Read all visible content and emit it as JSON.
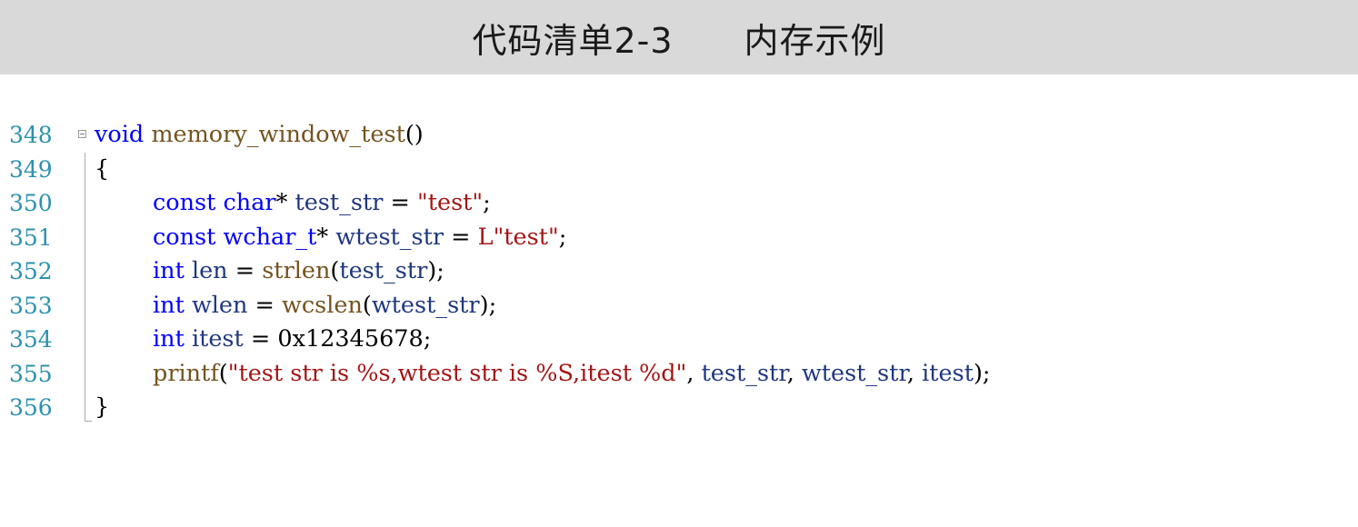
{
  "title": "代码清单2-3　　内存示例",
  "code_lines": [
    {
      "number": "348",
      "tokens": [
        "void",
        " ",
        "memory_window_test",
        "()"
      ]
    },
    {
      "number": "349",
      "tokens": [
        "{"
      ]
    },
    {
      "number": "350",
      "tokens": [
        "const",
        " ",
        "char",
        "*",
        " ",
        "test_str",
        " = ",
        "\"test\"",
        ";"
      ]
    },
    {
      "number": "351",
      "tokens": [
        "const",
        " ",
        "wchar_t",
        "*",
        " ",
        "wtest_str",
        " = ",
        "L\"test\"",
        ";"
      ]
    },
    {
      "number": "352",
      "tokens": [
        "int",
        " ",
        "len",
        " = ",
        "strlen",
        "(",
        "test_str",
        ");"
      ]
    },
    {
      "number": "353",
      "tokens": [
        "int",
        " ",
        "wlen",
        " = ",
        "wcslen",
        "(",
        "wtest_str",
        ");"
      ]
    },
    {
      "number": "354",
      "tokens": [
        "int",
        " ",
        "itest",
        " = ",
        "0x12345678",
        ";"
      ]
    },
    {
      "number": "355",
      "tokens": [
        "printf",
        "(",
        "\"test str is %s,wtest str is %S,itest %d\"",
        ", ",
        "test_str",
        ", ",
        "wtest_str",
        ", ",
        "itest",
        ");"
      ]
    },
    {
      "number": "356",
      "tokens": [
        "}"
      ]
    }
  ]
}
